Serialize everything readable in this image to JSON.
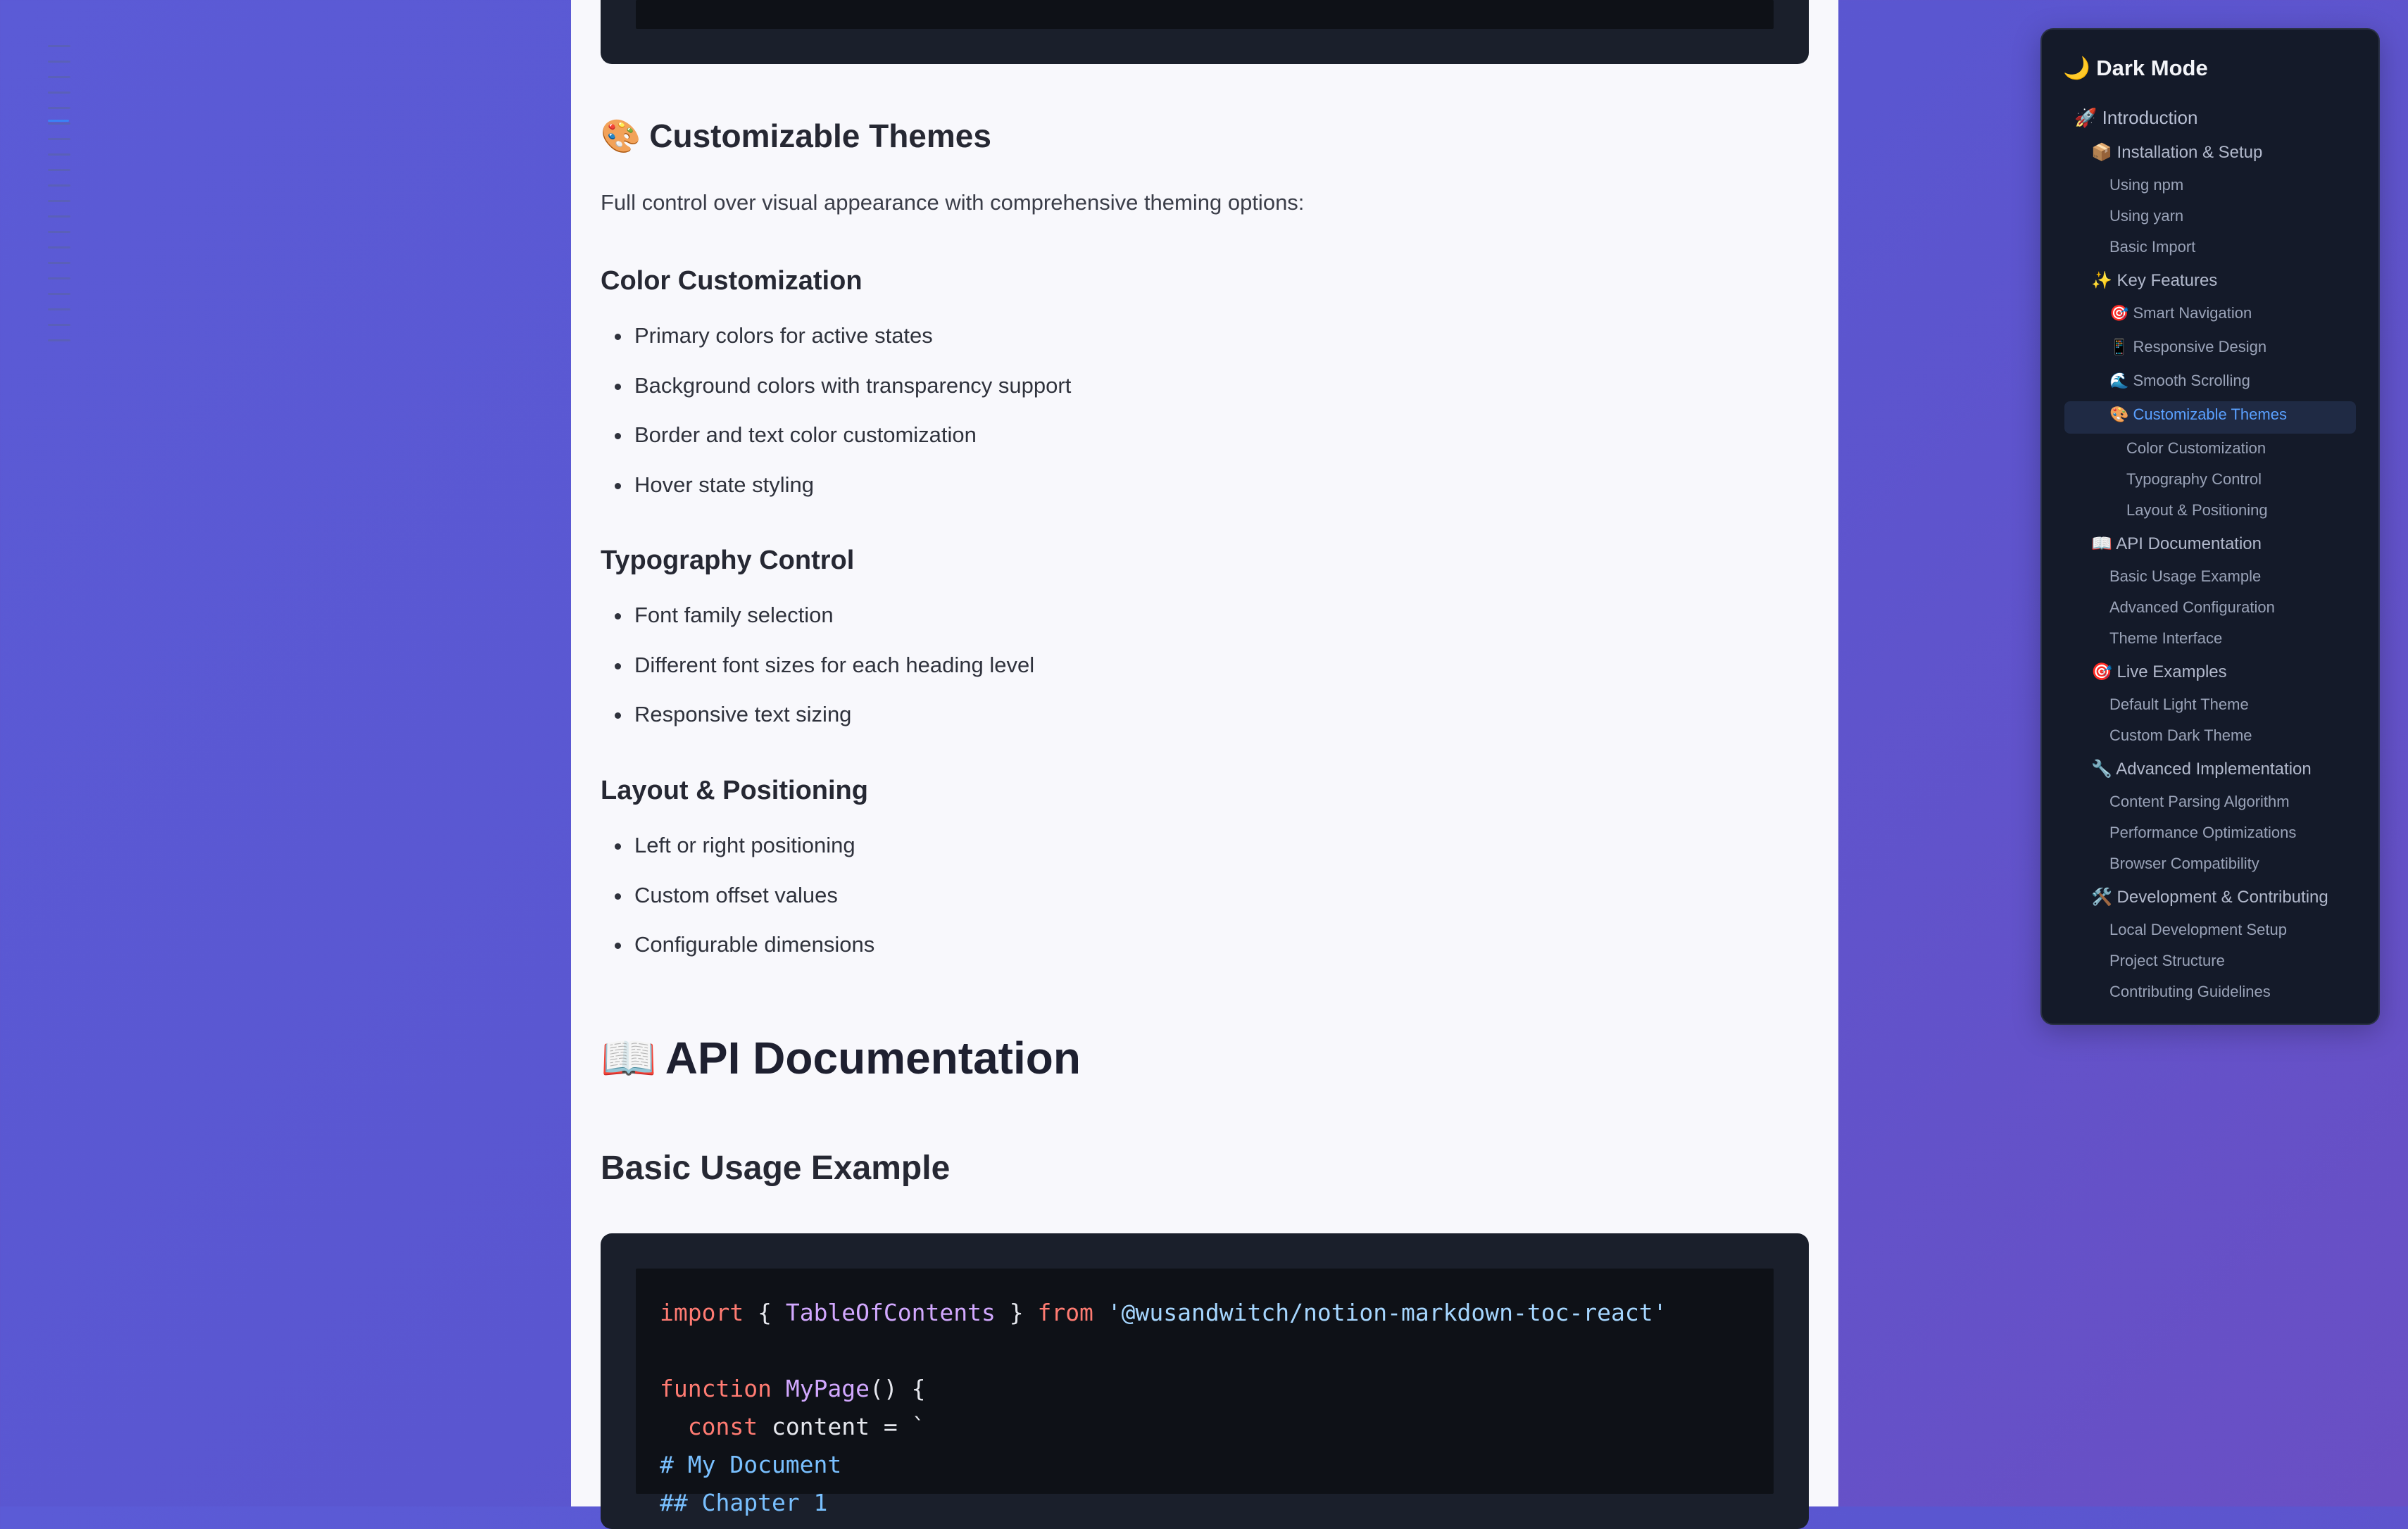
{
  "doc": {
    "themes_heading": "Customizable Themes",
    "themes_icon": "palette-icon",
    "themes_intro": "Full control over visual appearance with comprehensive theming options:",
    "color_heading": "Color Customization",
    "color_items": [
      "Primary colors for active states",
      "Background colors with transparency support",
      "Border and text color customization",
      "Hover state styling"
    ],
    "typo_heading": "Typography Control",
    "typo_items": [
      "Font family selection",
      "Different font sizes for each heading level",
      "Responsive text sizing"
    ],
    "layout_heading": "Layout & Positioning",
    "layout_items": [
      "Left or right positioning",
      "Custom offset values",
      "Configurable dimensions"
    ],
    "api_heading": "API Documentation",
    "api_icon": "book-icon",
    "basic_heading": "Basic Usage Example",
    "code": {
      "l1_kw1": "import",
      "l1_b1": " { ",
      "l1_name": "TableOfContents",
      "l1_b2": " } ",
      "l1_kw2": "from",
      "l1_str": " '@wusandwitch/notion-markdown-toc-react'",
      "l3_kw": "function",
      "l3_fn": " MyPage",
      "l3_rest": "() {",
      "l4_kw": "  const",
      "l4_rest": " content = `",
      "l5": "# My Document",
      "l6": "## Chapter 1"
    }
  },
  "toc": {
    "title": "Dark Mode",
    "title_icon": "moon-icon",
    "items": [
      {
        "label": "🚀 Introduction"
      },
      {
        "label": "📦 Installation & Setup"
      },
      {
        "label": "Using npm"
      },
      {
        "label": "Using yarn"
      },
      {
        "label": "Basic Import"
      },
      {
        "label": "✨ Key Features"
      },
      {
        "label": "🎯 Smart Navigation"
      },
      {
        "label": "📱 Responsive Design"
      },
      {
        "label": "🌊 Smooth Scrolling"
      },
      {
        "label": "🎨 Customizable Themes"
      },
      {
        "label": "Color Customization"
      },
      {
        "label": "Typography Control"
      },
      {
        "label": "Layout & Positioning"
      },
      {
        "label": "📖 API Documentation"
      },
      {
        "label": "Basic Usage Example"
      },
      {
        "label": "Advanced Configuration"
      },
      {
        "label": "Theme Interface"
      },
      {
        "label": "🎯 Live Examples"
      },
      {
        "label": "Default Light Theme"
      },
      {
        "label": "Custom Dark Theme"
      },
      {
        "label": "🔧 Advanced Implementation"
      },
      {
        "label": "Content Parsing Algorithm"
      },
      {
        "label": "Performance Optimizations"
      },
      {
        "label": "Browser Compatibility"
      },
      {
        "label": "🛠️ Development & Contributing"
      },
      {
        "label": "Local Development Setup"
      },
      {
        "label": "Project Structure"
      },
      {
        "label": "Contributing Guidelines"
      }
    ]
  },
  "colors": {
    "background": "#5b5bd6",
    "toc_background": "#141a29",
    "active_link": "#5aa0ff"
  }
}
